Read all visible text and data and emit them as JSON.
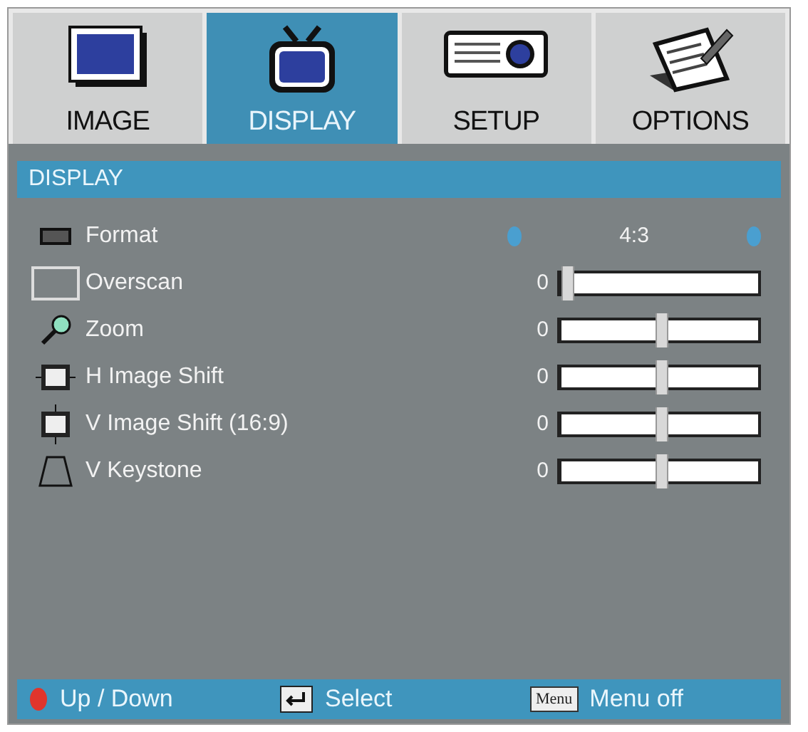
{
  "tabs": [
    {
      "label": "IMAGE",
      "selected": false
    },
    {
      "label": "DISPLAY",
      "selected": true
    },
    {
      "label": "SETUP",
      "selected": false
    },
    {
      "label": "OPTIONS",
      "selected": false
    }
  ],
  "section_title": "DISPLAY",
  "items": [
    {
      "kind": "selector",
      "label": "Format",
      "value": "4:3"
    },
    {
      "kind": "slider",
      "label": "Overscan",
      "reading": "0",
      "level": 0
    },
    {
      "kind": "slider",
      "label": "Zoom",
      "reading": "0",
      "level": 0.5
    },
    {
      "kind": "slider",
      "label": "H Image Shift",
      "reading": "0",
      "level": 0.5
    },
    {
      "kind": "slider",
      "label": "V Image Shift (16:9)",
      "reading": "0",
      "level": 0.5
    },
    {
      "kind": "slider",
      "label": "V Keystone",
      "reading": "0",
      "level": 0.5
    }
  ],
  "footer": [
    {
      "label": "Up / Down"
    },
    {
      "label": "Select"
    },
    {
      "key_text": "Menu",
      "label": "Menu off"
    }
  ]
}
